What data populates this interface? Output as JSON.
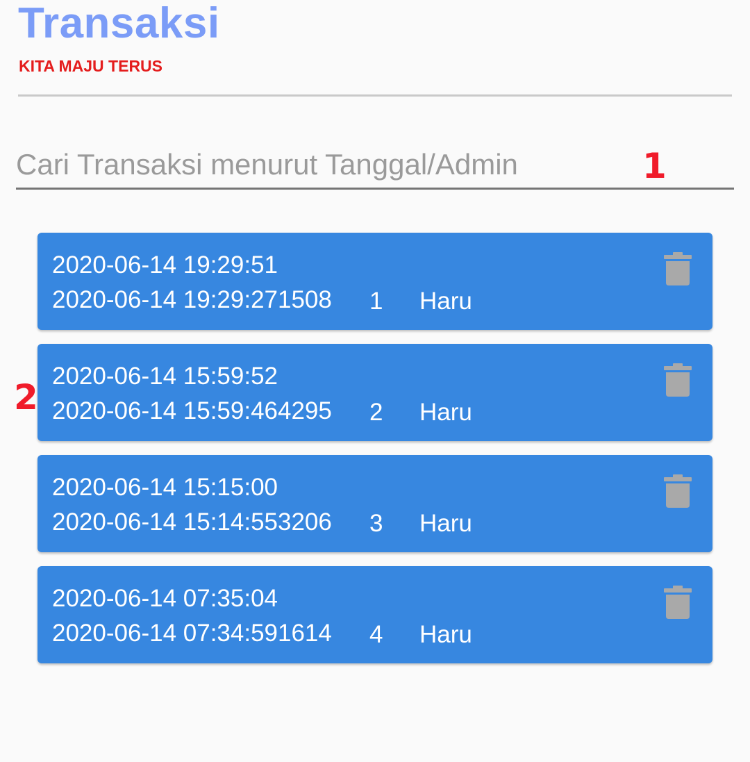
{
  "header": {
    "title": "Transaksi",
    "subtitle": "KITA MAJU TERUS"
  },
  "search": {
    "placeholder": "Cari Transaksi menurut Tanggal/Admin",
    "value": ""
  },
  "markers": {
    "one": "1",
    "two": "2"
  },
  "transactions": [
    {
      "datetime": "2020-06-14 19:29:51",
      "code": "2020-06-14 19:29:271508",
      "number": "1",
      "admin": "Haru",
      "action_icon": "trash-icon"
    },
    {
      "datetime": "2020-06-14 15:59:52",
      "code": "2020-06-14 15:59:464295",
      "number": "2",
      "admin": "Haru",
      "action_icon": "trash-icon"
    },
    {
      "datetime": "2020-06-14 15:15:00",
      "code": "2020-06-14 15:14:553206",
      "number": "3",
      "admin": "Haru",
      "action_icon": "trash-icon"
    },
    {
      "datetime": "2020-06-14 07:35:04",
      "code": "2020-06-14 07:34:591614",
      "number": "4",
      "admin": "Haru",
      "action_icon": "trash-icon"
    }
  ],
  "colors": {
    "title": "#7b9cf7",
    "subtitle": "#e41d1d",
    "card": "#3787e0",
    "marker": "#f01b2a",
    "trash": "#a9a9a9"
  }
}
